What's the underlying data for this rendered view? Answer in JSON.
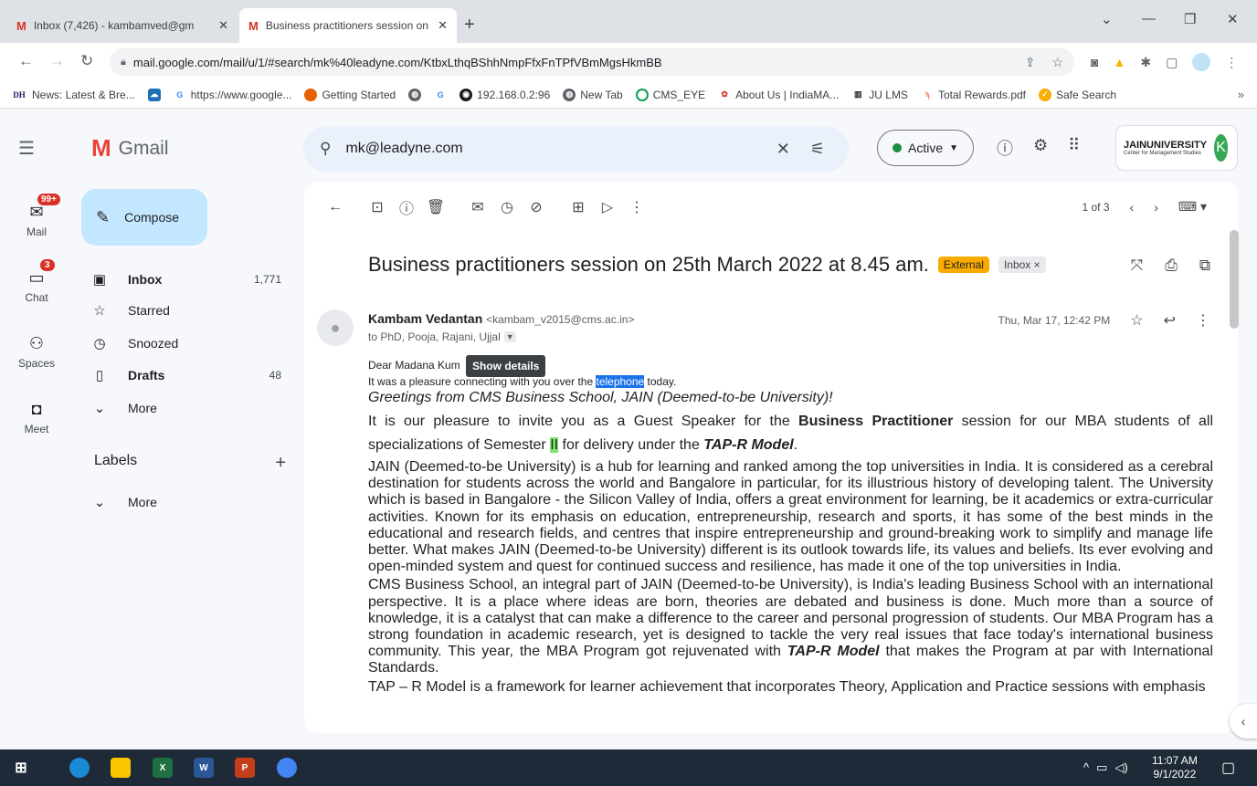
{
  "browser": {
    "tabs": [
      {
        "label": "Inbox (7,426) - kambamved@gm",
        "active": false
      },
      {
        "label": "Business practitioners session on",
        "active": true
      }
    ],
    "url": "mail.google.com/mail/u/1/#search/mk%40leadyne.com/KtbxLthqBShhNmpFfxFnTPfVBmMgsHkmBB",
    "bookmarks": [
      {
        "label": "News: Latest & Bre...",
        "icon": "DH"
      },
      {
        "label": "",
        "icon": "cloud-icon"
      },
      {
        "label": "https://www.google...",
        "icon": "G"
      },
      {
        "label": "Getting Started",
        "icon": "firefox-icon"
      },
      {
        "label": "",
        "icon": "globe-icon"
      },
      {
        "label": "",
        "icon": "G"
      },
      {
        "label": "192.168.0.2:96",
        "icon": "oracle-icon"
      },
      {
        "label": "New Tab",
        "icon": "globe-icon"
      },
      {
        "label": "CMS_EYE",
        "icon": "circle-icon"
      },
      {
        "label": "About Us | IndiaMA...",
        "icon": "indiamart-icon"
      },
      {
        "label": "JU LMS",
        "icon": "lms-icon"
      },
      {
        "label": "Total Rewards.pdf",
        "icon": "hubspot-icon"
      },
      {
        "label": "Safe Search",
        "icon": "check-icon"
      }
    ],
    "bookmarks_overflow": "»"
  },
  "gmail": {
    "logo_text": "Gmail",
    "search_value": "mk@leadyne.com",
    "status": "Active",
    "account_initial": "K",
    "org_name": "JAINUNIVERSITY",
    "org_sub": "Center for Management Studies"
  },
  "rail": [
    {
      "label": "Mail",
      "badge": "99+"
    },
    {
      "label": "Chat",
      "badge": "3"
    },
    {
      "label": "Spaces",
      "badge": ""
    },
    {
      "label": "Meet",
      "badge": ""
    }
  ],
  "nav": {
    "compose": "Compose",
    "items": [
      {
        "label": "Inbox",
        "count": "1,771",
        "bold": true
      },
      {
        "label": "Starred",
        "count": "",
        "bold": false
      },
      {
        "label": "Snoozed",
        "count": "",
        "bold": false
      },
      {
        "label": "Drafts",
        "count": "48",
        "bold": true
      },
      {
        "label": "More",
        "count": "",
        "bold": false
      }
    ],
    "labels_title": "Labels",
    "labels_more": "More"
  },
  "email": {
    "pager": "1 of 3",
    "subject": "Business practitioners session on 25th March 2022 at 8.45 am.",
    "badge_external": "External",
    "badge_inbox": "Inbox ×",
    "sender_name": "Kambam Vedantan",
    "sender_email": "<kambam_v2015@cms.ac.in>",
    "recipients": "to PhD, Pooja, Rajani, Ujjal",
    "date": "Thu, Mar 17, 12:42 PM",
    "tooltip": "Show details",
    "greeting": "Dear Madana Kum",
    "line1_before": "It was a pleasure connecting with you over the ",
    "line1_highlight": "telephone",
    "line1_after": " today.",
    "line2": "Greetings from CMS Business School, JAIN (Deemed-to-be University)!",
    "p1_a": "It is our pleasure to invite you as a Guest Speaker for the ",
    "p1_bold": "Business Practitioner",
    "p1_b": " session for our MBA students of all specializations of Semester ",
    "p1_hl": "II",
    "p1_c": " for delivery under the ",
    "p1_bi": "TAP-R Model",
    "p1_d": ".",
    "p2": "JAIN (Deemed-to-be University) is a hub for learning and ranked among the top universities in India.  It is considered as a cerebral destination for students across the world and Bangalore in particular, for its illustrious history of developing talent.  The University which is based in Bangalore - the Silicon Valley of India, offers a great environment for learning, be it academics or extra-curricular activities. Known for its emphasis on education, entrepreneurship, research and sports, it has some of the best minds in the educational and research fields, and centres that inspire entrepreneurship and ground-breaking work to simplify and manage life better.  What makes JAIN (Deemed-to-be University) different is its outlook towards life, its values and beliefs. Its ever evolving and open-minded system and quest for continued success and resilience, has made it one of the top universities in India.",
    "p3_a": "CMS Business School, an integral part of JAIN (Deemed-to-be University), is India's leading Business School with an international perspective. It is a place where ideas are born, theories are debated and business is done. Much more than a source of knowledge, it is a catalyst that can make a difference to the career and personal progression of students. Our MBA Program has a strong foundation in academic research, yet is designed to tackle the very real issues that face today's international business community. This year, the MBA Program got rejuvenated with ",
    "p3_bi": "TAP-R Model",
    "p3_b": " that makes the Program at par with International Standards.",
    "p4": "TAP – R Model is a framework for learner achievement that incorporates Theory, Application and Practice sessions with emphasis"
  },
  "taskbar": {
    "time": "11:07 AM",
    "date": "9/1/2022"
  },
  "colors": {
    "compose_bg": "#c2e7ff",
    "external_badge": "#f9ab00",
    "avatar": "#35a853",
    "active_dot": "#1e8e3e",
    "taskbar": "#1f2a38"
  }
}
